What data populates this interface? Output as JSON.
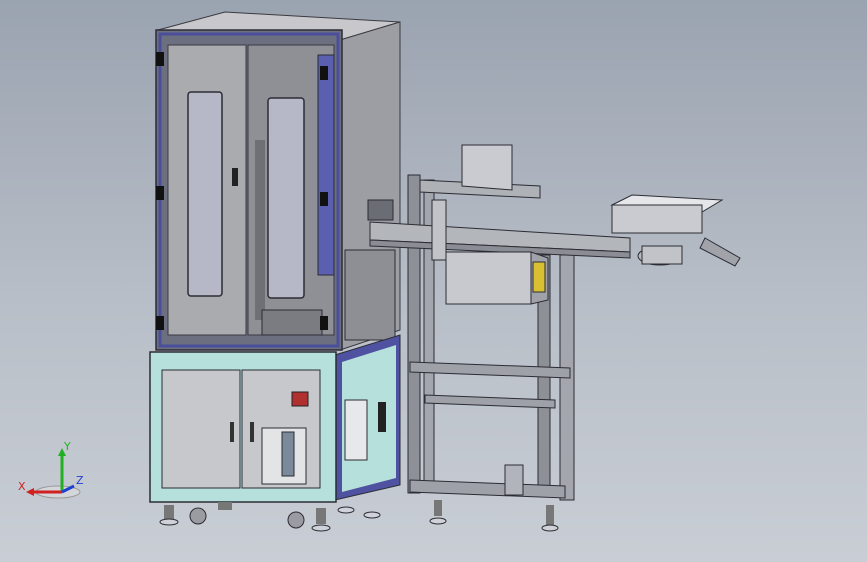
{
  "scene": {
    "background": [
      "#9aa3b0",
      "#c9ced5"
    ],
    "frame_color": "#7b7f87",
    "panel_color": "#a9abaf",
    "cabinet_color": "#b6e0dc",
    "blue_trim": "#4b4f9a"
  },
  "triad": {
    "x_label": "X",
    "y_label": "Y",
    "z_label": "Z",
    "x_color": "#d02020",
    "y_color": "#22b022",
    "z_color": "#2040d0"
  }
}
